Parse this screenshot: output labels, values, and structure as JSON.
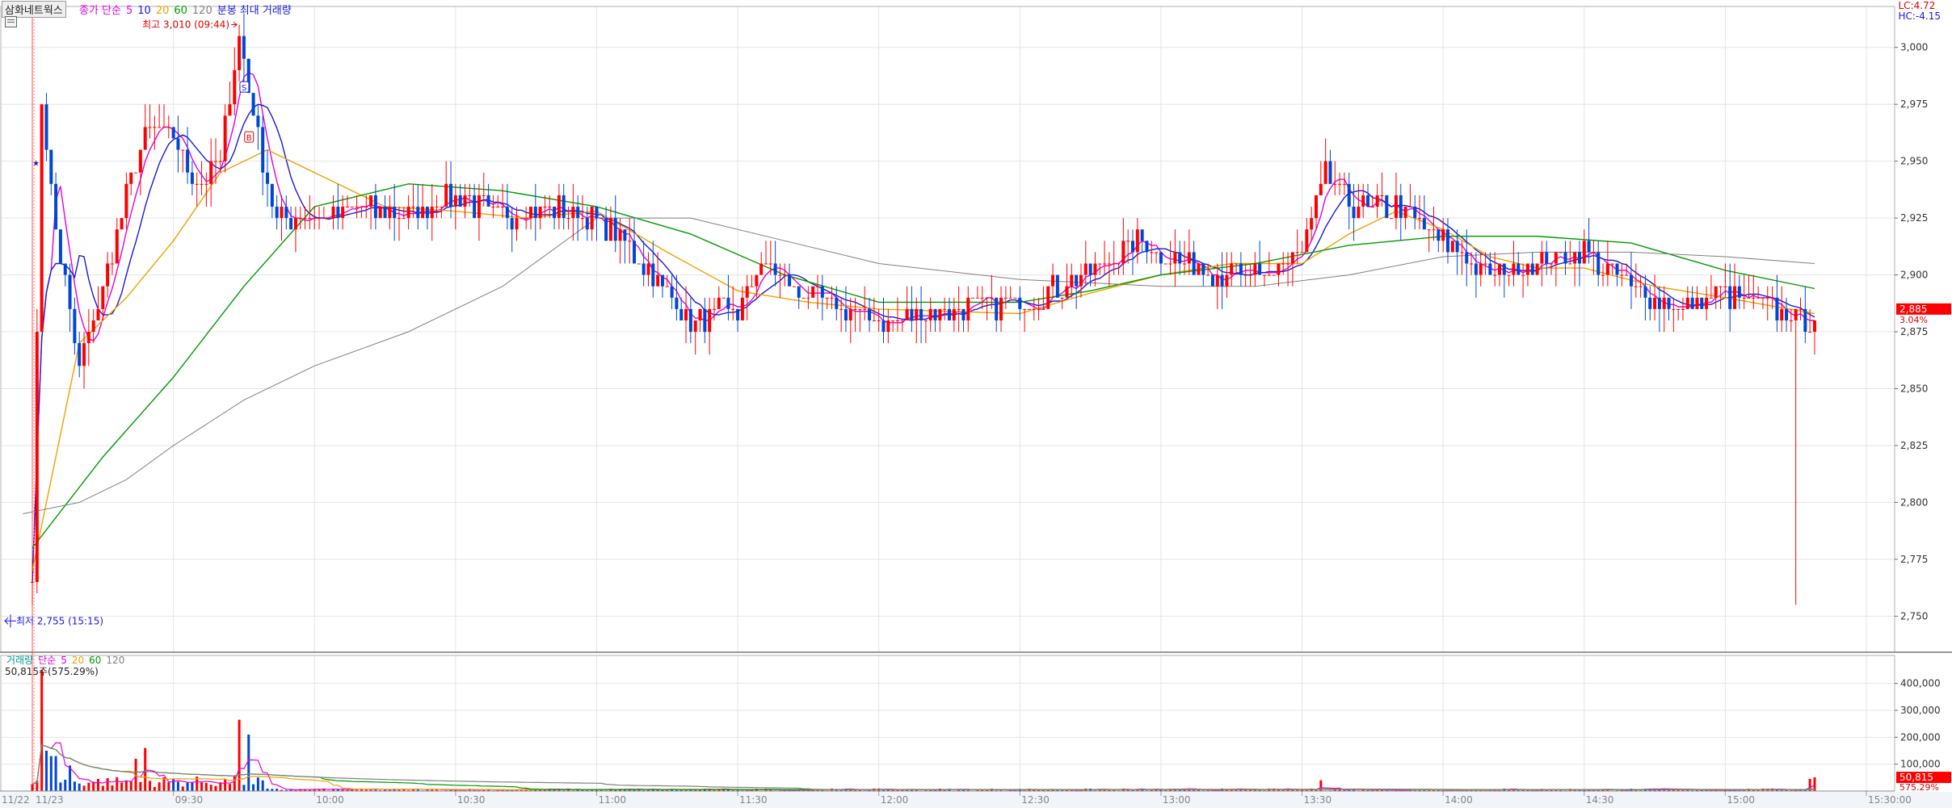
{
  "window": {
    "stock_name": "삼화네트웍스",
    "legend": {
      "prefix": "종가 단순",
      "ma_periods": [
        "5",
        "10",
        "20",
        "60",
        "120"
      ],
      "ma_colors": [
        "#e000e0",
        "#1a1ad6",
        "#f0a000",
        "#009a00",
        "#808080"
      ],
      "suffix": "분봉 최대 거래량"
    },
    "lc_label": "LC:4.72",
    "hc_label": "HC:-4.15"
  },
  "colors": {
    "up": "#ff0000",
    "down": "#0046d5",
    "grid": "#e4e4e4",
    "axis_bg": "#dfe6f2",
    "current_price_bg": "#ff0000"
  },
  "chart_data": [
    {
      "type": "candlestick",
      "title": "",
      "interval": "1-minute",
      "dates": [
        "11/22",
        "11/23"
      ],
      "xlabel": "",
      "ylabel": "",
      "x_ticks": [
        "09:30",
        "10:00",
        "10:30",
        "11:00",
        "11:30",
        "12:00",
        "12:30",
        "13:00",
        "13:30",
        "14:00",
        "14:30",
        "15:00",
        "15:30:00"
      ],
      "y_ticks": [
        2750,
        2775,
        2800,
        2825,
        2850,
        2875,
        2900,
        2925,
        2950,
        2975,
        3000
      ],
      "y_tick_labels": [
        "2,750",
        "2,775",
        "2,800",
        "2,825",
        "2,850",
        "2,875",
        "2,900",
        "2,925",
        "2,950",
        "2,975",
        "3,000"
      ],
      "ylim": [
        2737,
        3018
      ],
      "prev_day_close": 2765,
      "open": 2765,
      "high": 3010,
      "high_time": "09:44",
      "high_label": "최고 3,010 (09:44)",
      "low": 2755,
      "low_time": "15:15",
      "low_label": "최저 2,755 (15:15)",
      "last": 2885,
      "last_label": "2,885",
      "change_pct_label": "3.04%",
      "price_path": [
        [
          "09:00",
          2765
        ],
        [
          "09:02",
          2975
        ],
        [
          "09:05",
          2920
        ],
        [
          "09:10",
          2860
        ],
        [
          "09:15",
          2895
        ],
        [
          "09:20",
          2935
        ],
        [
          "09:25",
          2965
        ],
        [
          "09:30",
          2960
        ],
        [
          "09:35",
          2940
        ],
        [
          "09:40",
          2950
        ],
        [
          "09:44",
          3005
        ],
        [
          "09:48",
          2960
        ],
        [
          "09:52",
          2925
        ],
        [
          "10:00",
          2925
        ],
        [
          "10:10",
          2930
        ],
        [
          "10:20",
          2925
        ],
        [
          "10:30",
          2935
        ],
        [
          "10:40",
          2925
        ],
        [
          "10:50",
          2930
        ],
        [
          "11:00",
          2925
        ],
        [
          "11:10",
          2905
        ],
        [
          "11:20",
          2880
        ],
        [
          "11:30",
          2885
        ],
        [
          "11:35",
          2905
        ],
        [
          "11:45",
          2890
        ],
        [
          "12:00",
          2880
        ],
        [
          "12:15",
          2885
        ],
        [
          "12:30",
          2888
        ],
        [
          "12:45",
          2900
        ],
        [
          "12:55",
          2915
        ],
        [
          "13:05",
          2905
        ],
        [
          "13:20",
          2898
        ],
        [
          "13:30",
          2910
        ],
        [
          "13:35",
          2945
        ],
        [
          "13:40",
          2930
        ],
        [
          "13:50",
          2930
        ],
        [
          "14:00",
          2915
        ],
        [
          "14:10",
          2900
        ],
        [
          "14:20",
          2905
        ],
        [
          "14:30",
          2910
        ],
        [
          "14:40",
          2895
        ],
        [
          "14:50",
          2885
        ],
        [
          "15:00",
          2892
        ],
        [
          "15:10",
          2885
        ],
        [
          "15:19",
          2880
        ]
      ],
      "moving_averages": [
        {
          "name": "5",
          "color": "#e000e0"
        },
        {
          "name": "10",
          "color": "#1a1ad6"
        },
        {
          "name": "20",
          "color": "#f0a000",
          "values": [
            [
              "09:00",
              2770
            ],
            [
              "09:10",
              2870
            ],
            [
              "09:20",
              2890
            ],
            [
              "09:30",
              2915
            ],
            [
              "09:40",
              2945
            ],
            [
              "09:50",
              2955
            ],
            [
              "10:00",
              2945
            ],
            [
              "10:15",
              2930
            ],
            [
              "10:30",
              2928
            ],
            [
              "10:45",
              2925
            ],
            [
              "11:00",
              2928
            ],
            [
              "11:15",
              2910
            ],
            [
              "11:30",
              2893
            ],
            [
              "11:45",
              2888
            ],
            [
              "12:00",
              2885
            ],
            [
              "12:30",
              2883
            ],
            [
              "12:45",
              2892
            ],
            [
              "13:00",
              2900
            ],
            [
              "13:15",
              2905
            ],
            [
              "13:30",
              2905
            ],
            [
              "13:40",
              2918
            ],
            [
              "13:50",
              2928
            ],
            [
              "14:00",
              2920
            ],
            [
              "14:10",
              2908
            ],
            [
              "14:20",
              2903
            ],
            [
              "14:30",
              2903
            ],
            [
              "14:45",
              2895
            ],
            [
              "15:00",
              2890
            ],
            [
              "15:19",
              2883
            ]
          ]
        },
        {
          "name": "60",
          "color": "#009a00",
          "values": [
            [
              "09:00",
              2780
            ],
            [
              "09:15",
              2820
            ],
            [
              "09:30",
              2855
            ],
            [
              "09:45",
              2895
            ],
            [
              "10:00",
              2930
            ],
            [
              "10:20",
              2940
            ],
            [
              "10:40",
              2937
            ],
            [
              "11:00",
              2930
            ],
            [
              "11:20",
              2918
            ],
            [
              "11:40",
              2900
            ],
            [
              "12:00",
              2888
            ],
            [
              "12:30",
              2888
            ],
            [
              "12:45",
              2893
            ],
            [
              "13:00",
              2900
            ],
            [
              "13:20",
              2905
            ],
            [
              "13:40",
              2913
            ],
            [
              "14:00",
              2917
            ],
            [
              "14:20",
              2917
            ],
            [
              "14:40",
              2914
            ],
            [
              "15:00",
              2902
            ],
            [
              "15:19",
              2894
            ]
          ]
        },
        {
          "name": "120",
          "color": "#808080",
          "values": [
            [
              "08:58",
              2795
            ],
            [
              "09:10",
              2800
            ],
            [
              "09:20",
              2810
            ],
            [
              "09:30",
              2825
            ],
            [
              "09:45",
              2845
            ],
            [
              "10:00",
              2860
            ],
            [
              "10:20",
              2875
            ],
            [
              "10:40",
              2895
            ],
            [
              "11:00",
              2925
            ],
            [
              "11:20",
              2925
            ],
            [
              "11:40",
              2915
            ],
            [
              "12:00",
              2905
            ],
            [
              "12:30",
              2898
            ],
            [
              "13:00",
              2895
            ],
            [
              "13:20",
              2895
            ],
            [
              "13:40",
              2900
            ],
            [
              "14:00",
              2908
            ],
            [
              "14:20",
              2910
            ],
            [
              "14:40",
              2910
            ],
            [
              "15:00",
              2908
            ],
            [
              "15:19",
              2905
            ]
          ]
        }
      ],
      "markers": [
        {
          "label": "S",
          "time": "09:45",
          "price": 2980
        },
        {
          "label": "B",
          "time": "09:46",
          "price": 2958
        }
      ]
    },
    {
      "type": "bar",
      "title": "",
      "legend_label": "거래량",
      "ma_prefix": "단순",
      "ma_periods": [
        "5",
        "20",
        "60",
        "120"
      ],
      "ma_colors": [
        "#e000e0",
        "#f0a000",
        "#009a00",
        "#808080"
      ],
      "current_volume_label": "50,815주(575.29%)",
      "y_ticks": [
        100000,
        200000,
        300000,
        400000
      ],
      "y_tick_labels": [
        "100,000",
        "200,000",
        "300,000",
        "400,000"
      ],
      "ylim": [
        0,
        480000
      ],
      "last_volume": 50815,
      "last_volume_label": "50,815",
      "last_volume_pct_label": "575.29%",
      "spikes": [
        [
          "09:02",
          450000
        ],
        [
          "09:03",
          150000
        ],
        [
          "09:04",
          130000
        ],
        [
          "09:05",
          130000
        ],
        [
          "09:08",
          95000
        ],
        [
          "09:22",
          120000
        ],
        [
          "09:24",
          160000
        ],
        [
          "09:44",
          265000
        ],
        [
          "09:46",
          210000
        ],
        [
          "13:34",
          40000
        ],
        [
          "15:18",
          45000
        ]
      ]
    }
  ]
}
